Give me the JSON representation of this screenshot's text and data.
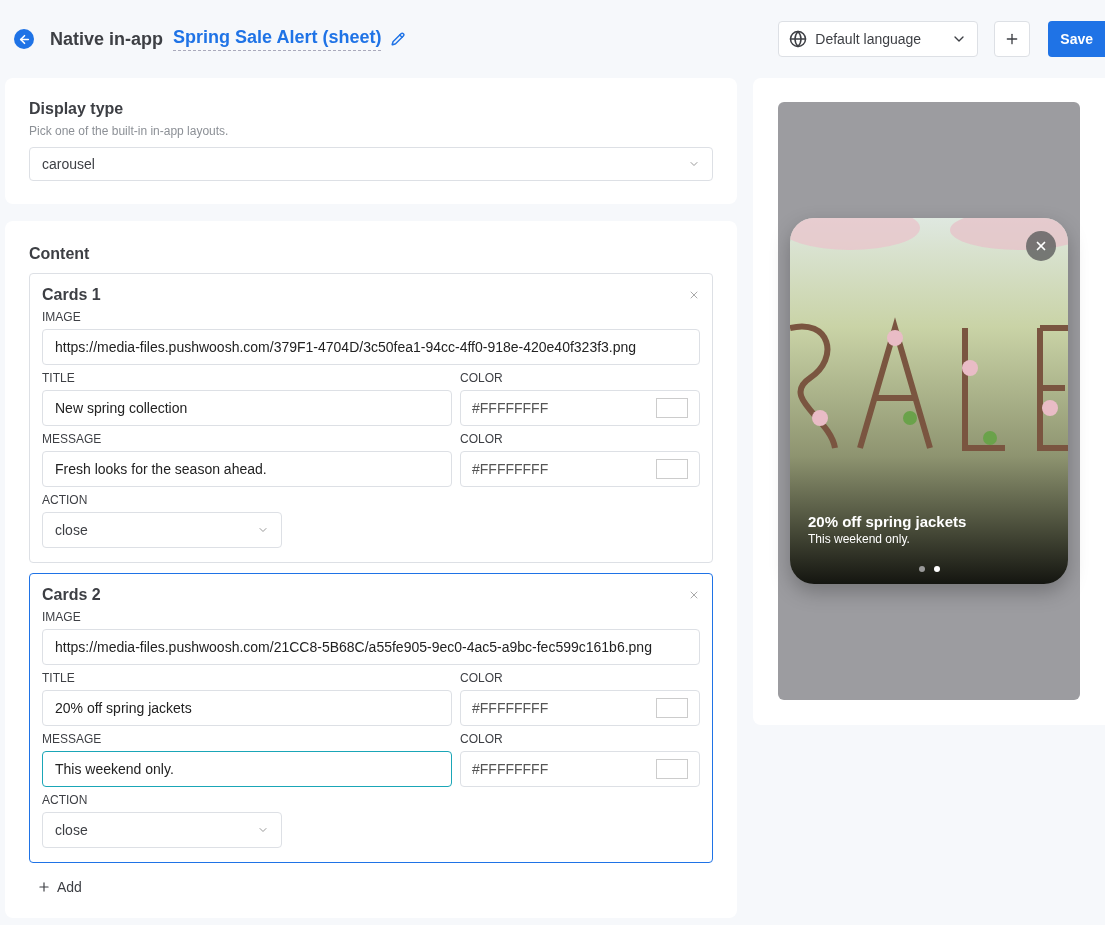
{
  "header": {
    "section": "Native in-app",
    "title": "Spring Sale Alert (sheet)",
    "language": "Default language",
    "save": "Save"
  },
  "display_type": {
    "heading": "Display type",
    "hint": "Pick one of the built-in in-app layouts.",
    "value": "carousel"
  },
  "content": {
    "heading": "Content",
    "add": "Add",
    "cards": [
      {
        "title": "Cards 1",
        "selected": false,
        "image_label": "IMAGE",
        "image": "https://media-files.pushwoosh.com/379F1-4704D/3c50fea1-94cc-4ff0-918e-420e40f323f3.png",
        "title_label": "TITLE",
        "title_value": "New spring collection",
        "title_color_label": "COLOR",
        "title_color": "#FFFFFFFF",
        "message_label": "MESSAGE",
        "message": "Fresh looks for the season ahead.",
        "message_focused": false,
        "message_color_label": "COLOR",
        "message_color": "#FFFFFFFF",
        "action_label": "ACTION",
        "action": "close"
      },
      {
        "title": "Cards 2",
        "selected": true,
        "image_label": "IMAGE",
        "image": "https://media-files.pushwoosh.com/21CC8-5B68C/a55fe905-9ec0-4ac5-a9bc-fec599c161b6.png",
        "title_label": "TITLE",
        "title_value": "20% off spring jackets",
        "title_color_label": "COLOR",
        "title_color": "#FFFFFFFF",
        "message_label": "MESSAGE",
        "message": "This weekend only.",
        "message_focused": true,
        "message_color_label": "COLOR",
        "message_color": "#FFFFFFFF",
        "action_label": "ACTION",
        "action": "close"
      }
    ]
  },
  "preview": {
    "title": "20% off spring jackets",
    "message": "This weekend only.",
    "dots": [
      {
        "selected": false
      },
      {
        "selected": true
      }
    ]
  }
}
